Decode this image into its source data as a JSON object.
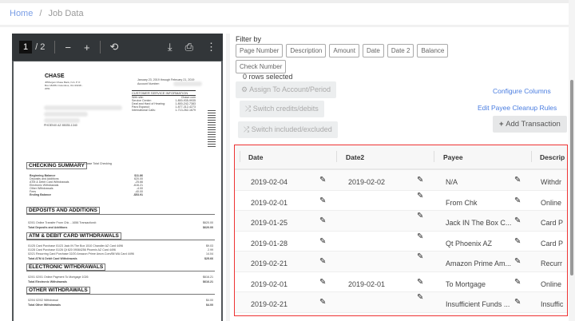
{
  "breadcrumb": {
    "home": "Home",
    "sep": "/",
    "current": "Job Data"
  },
  "pdf": {
    "page": "1",
    "total": "/ 2",
    "minus": "−",
    "plus": "+",
    "rotate": "⟲",
    "download": "⤓",
    "print": "⎙",
    "more": "⋮",
    "bank": "CHASE",
    "bank_addr": "JPMorgan Chase Bank, N.A. P O Box 182051 Columbus, OH 43218 - 2051",
    "period": "January 23, 2019 through February 21, 2019",
    "account_label": "Account Number:",
    "csi": "CUSTOMER SERVICE INFORMATION",
    "csi_rows": [
      [
        "Web site:",
        "Chase.com"
      ],
      [
        "Service Center:",
        "1-800-935-9935"
      ],
      [
        "Deaf and Hard of Hearing:",
        "1-800-242-7383"
      ],
      [
        "Para Espanol:",
        "1-877-312-4273"
      ],
      [
        "International Calls:",
        "1-713-262-1679"
      ]
    ],
    "addr_city": "PHOENIX AZ 85035-1340",
    "sections": [
      "CHECKING SUMMARY",
      "DEPOSITS AND ADDITIONS",
      "ATM & DEBIT CARD WITHDRAWALS",
      "ELECTRONIC WITHDRAWALS",
      "OTHER WITHDRAWALS"
    ],
    "summary_sub": "Chase Total Checking",
    "summary": [
      [
        "Beginning Balance",
        "$11.86"
      ],
      [
        "Deposits and Additions",
        "620.00"
      ],
      [
        "ATM & Debit Card Withdrawals",
        "-25.66"
      ],
      [
        "Electronic Withdrawals",
        "-616.21"
      ],
      [
        "Other Withdrawals",
        "-4.00"
      ],
      [
        "Fees",
        "-40.00"
      ],
      [
        "Ending Balance",
        "-$53.91"
      ]
    ],
    "deposit_line": "02/01  Online Transfer From Chk ...1656 Transaction#:",
    "deposit_amt": "$620.00",
    "deposit_total": "Total Deposits and Additions",
    "deposit_total_amt": "$620.00",
    "atm_lines": [
      [
        "01/25  Card Purchase   01/23 Jack IN The Box 1510 Chandler AZ Card 4496",
        "$9.03"
      ],
      [
        "01/28  Card Purchase   01/26 Qt 620   09084256 Phoenix AZ Card 4496",
        "2.99"
      ],
      [
        "02/21  Recurring Card Purchase 02/20 Amazon Prime Amzn.Com/Bil WA Card 4496",
        "14.04"
      ]
    ],
    "atm_total": "Total ATM & Debit Card Withdrawals",
    "atm_total_amt": "$25.66",
    "elec_line": "02/01  02/01 Online Payment             To Mortgage 1026",
    "elec_amt": "$616.21",
    "elec_total": "Total Electronic Withdrawals",
    "elec_total_amt": "$616.21",
    "other_line": "02/04  02/02 Withdrawal",
    "other_amt": "$4.00",
    "other_total": "Total Other Withdrawals",
    "other_total_amt": "$4.00"
  },
  "filter": {
    "label": "Filter by",
    "chips": [
      "Page Number",
      "Description",
      "Amount",
      "Date",
      "Date 2",
      "Balance",
      "Check Number"
    ]
  },
  "rows_selected": "0 rows selected",
  "actions": {
    "assign": "Assign To Account/Period",
    "switch_cd": "Switch credits/debits",
    "switch_ie": "Switch included/excluded",
    "configure": "Configure Columns",
    "edit_rules": "Edit Payee Cleanup Rules",
    "add": "Add Transaction"
  },
  "table": {
    "headers": [
      "Date",
      "Date2",
      "Payee",
      "Descrip"
    ],
    "rows": [
      [
        "2019-02-04",
        "2019-02-02",
        "N/A",
        "Withdr"
      ],
      [
        "2019-02-01",
        "",
        "From Chk",
        "Online"
      ],
      [
        "2019-01-25",
        "",
        "Jack IN The Box C...",
        "Card P"
      ],
      [
        "2019-01-28",
        "",
        "Qt Phoenix AZ",
        "Card P"
      ],
      [
        "2019-02-21",
        "",
        "Amazon Prime Am...",
        "Recurr"
      ],
      [
        "2019-02-01",
        "2019-02-01",
        "To Mortgage",
        "Online"
      ],
      [
        "2019-02-21",
        "",
        "Insufficient Funds ...",
        "Insuffic"
      ]
    ]
  }
}
